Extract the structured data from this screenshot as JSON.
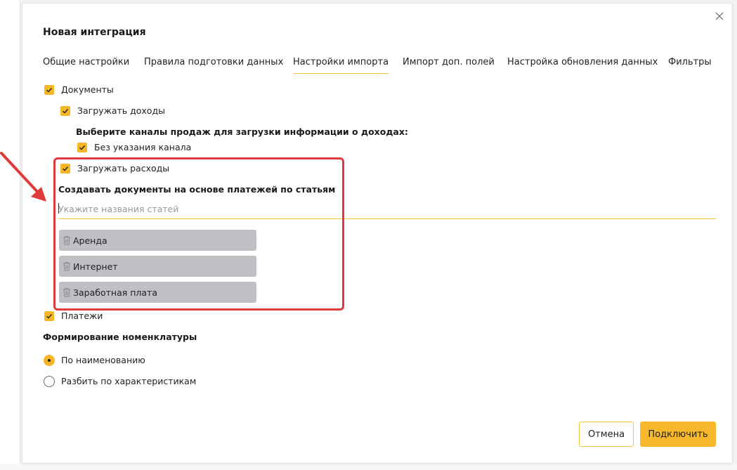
{
  "dialog": {
    "title": "Новая интеграция"
  },
  "tabs": [
    {
      "label": "Общие настройки",
      "active": false
    },
    {
      "label": "Правила подготовки данных",
      "active": false
    },
    {
      "label": "Настройки импорта",
      "active": true
    },
    {
      "label": "Импорт доп. полей",
      "active": false
    },
    {
      "label": "Настройка обновления данных",
      "active": false
    },
    {
      "label": "Фильтры",
      "active": false
    }
  ],
  "import": {
    "documents_label": "Документы",
    "documents_checked": true,
    "load_income_label": "Загружать доходы",
    "load_income_checked": true,
    "channels_heading": "Выберите каналы продаж для загрузки информации о доходах:",
    "no_channel_label": "Без указания канала",
    "no_channel_checked": true,
    "load_expenses_label": "Загружать расходы",
    "load_expenses_checked": true,
    "create_docs_heading": "Создавать документы на основе платежей по статьям",
    "articles_placeholder": "Укажите названия статей",
    "articles_value": "",
    "articles": [
      "Аренда",
      "Интернет",
      "Заработная плата"
    ],
    "payments_label": "Платежи",
    "payments_checked": true
  },
  "nomenclature": {
    "heading": "Формирование номенклатуры",
    "options": [
      {
        "label": "По наименованию",
        "selected": true
      },
      {
        "label": "Разбить по характеристикам",
        "selected": false
      }
    ]
  },
  "buttons": {
    "cancel": "Отмена",
    "connect": "Подключить"
  },
  "colors": {
    "accent": "#f5b726",
    "highlight": "#e03a3a",
    "chip": "#bfbfc4"
  }
}
